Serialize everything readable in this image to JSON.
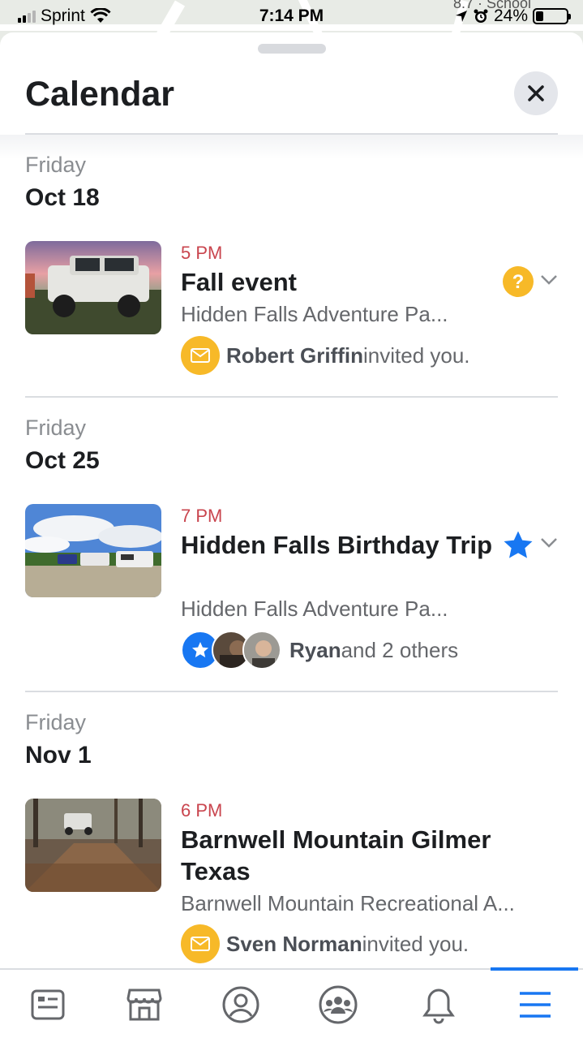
{
  "status_bar": {
    "carrier": "Sprint",
    "time": "7:14 PM",
    "battery": "24%",
    "battery_level": 0.24,
    "map_text": "8.7 · School"
  },
  "header": {
    "title": "Calendar"
  },
  "events": [
    {
      "day": "Friday",
      "date": "Oct 18",
      "time": "5 PM",
      "title": "Fall event",
      "location": "Hidden Falls Adventure Pa...",
      "status_icon": "question-icon",
      "invite_name": "Robert Griffin",
      "invite_text": " invited you."
    },
    {
      "day": "Friday",
      "date": "Oct 25",
      "time": "7 PM",
      "title": "Hidden Falls Birthday Trip",
      "location": "Hidden Falls Adventure Pa...",
      "status_icon": "star-icon",
      "friends_name": "Ryan",
      "friends_text": " and 2 others"
    },
    {
      "day": "Friday",
      "date": "Nov 1",
      "time": "6 PM",
      "title": "Barnwell Mountain Gilmer Texas",
      "location": "Barnwell Mountain Recreational A...",
      "invite_name": "Sven Norman",
      "invite_text": " invited you."
    }
  ],
  "tabs": [
    "news-feed-icon",
    "marketplace-icon",
    "profile-icon",
    "groups-icon",
    "notifications-icon",
    "menu-icon"
  ],
  "colors": {
    "accent": "#1877f2",
    "time_red": "#c9454e",
    "badge_yellow": "#f7b928"
  }
}
